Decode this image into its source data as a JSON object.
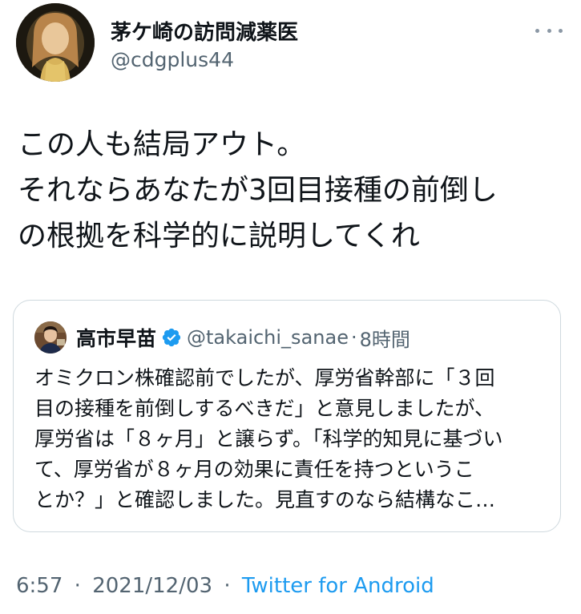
{
  "author": {
    "name": "茅ケ崎の訪問減薬医",
    "handle": "@cdgplus44",
    "avatar_icon": "profile-avatar-icon"
  },
  "more_icon": "more-options-icon",
  "tweet_text": [
    "この人も結局アウト。",
    "それならあなたが3回目接種の前倒し",
    "の根拠を科学的に説明してくれ"
  ],
  "quoted_tweet": {
    "name": "高市早苗",
    "verified_icon": "verified-badge-icon",
    "handle": "@takaichi_sanae",
    "separator": "·",
    "time": "8時間",
    "text_lines": [
      "オミクロン株確認前でしたが、厚労省幹部に「３回",
      "目の接種を前倒しするべきだ」と意見しましたが、",
      "厚労省は「８ヶ月」と譲らず。「科学的知見に基づい",
      "て、厚労省が８ヶ月の効果に責任を持つというこ",
      "とか？」と確認しました。見直すのなら結構なこ…"
    ]
  },
  "footer": {
    "time": "6:57",
    "sep1": "·",
    "date": "2021/12/03",
    "sep2": "·",
    "source": "Twitter for Android"
  },
  "colors": {
    "text": "#0f1419",
    "secondary": "#536471",
    "link": "#1d9bf0",
    "border": "#cfd9de",
    "verified": "#1d9bf0"
  }
}
